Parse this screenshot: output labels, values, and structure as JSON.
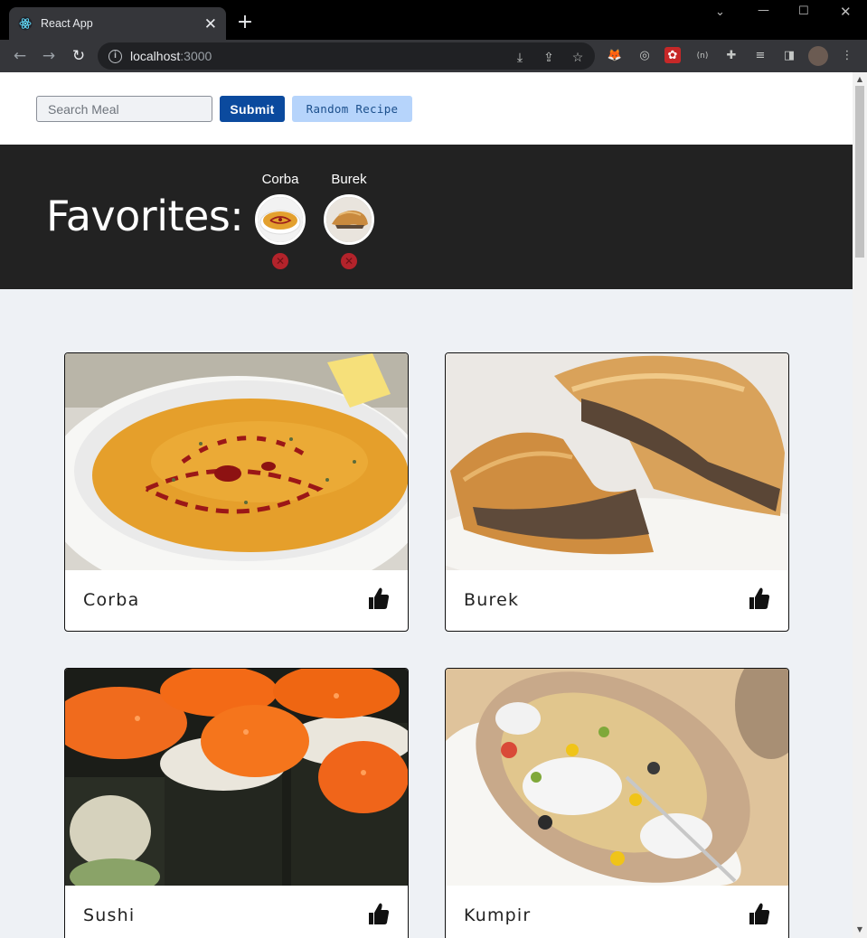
{
  "browser": {
    "tab_title": "React App",
    "url_host": "localhost",
    "url_port": ":3000"
  },
  "search": {
    "placeholder": "Search Meal",
    "submit_label": "Submit",
    "random_label": "Random Recipe"
  },
  "favorites": {
    "title": "Favorites:",
    "items": [
      {
        "name": "Corba",
        "image": "soup"
      },
      {
        "name": "Burek",
        "image": "pastry"
      }
    ]
  },
  "meals": [
    {
      "name": "Corba",
      "image": "soup",
      "liked": true
    },
    {
      "name": "Burek",
      "image": "pastry",
      "liked": true
    },
    {
      "name": "Sushi",
      "image": "sushi",
      "liked": true
    },
    {
      "name": "Kumpir",
      "image": "potato",
      "liked": true
    }
  ],
  "colors": {
    "submit_bg": "#0b4a9e",
    "random_bg": "#b6d4fb",
    "favorites_bg": "#222222",
    "remove_bg": "#b3232b",
    "page_bg": "#eef1f5"
  }
}
